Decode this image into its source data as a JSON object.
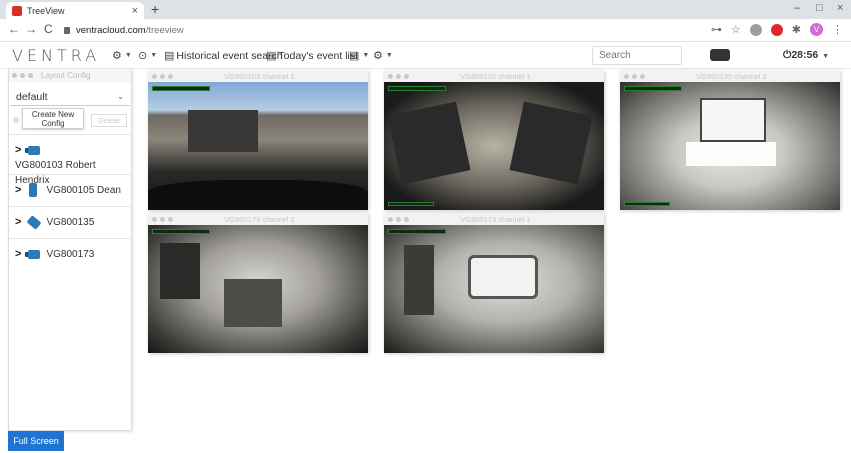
{
  "browser": {
    "tab_title": "TreeView",
    "tab_close": "×",
    "new_tab": "+",
    "url_domain": "ventracloud.com",
    "url_path": "/treeview",
    "nav_back": "←",
    "nav_forward": "→",
    "nav_reload": "C",
    "win_minimize": "–",
    "win_maximize": "□",
    "win_close": "×",
    "ext_key": "⊶",
    "ext_star": "☆",
    "ext_puzzle": "✱",
    "ext_menu": "⋮",
    "avatar_letter": "V"
  },
  "toolbar": {
    "brand": "VENTRA",
    "historical_label": "Historical event search",
    "today_label": "Today's event list",
    "search_placeholder": "Search",
    "timer": "28:56",
    "caret": "▼"
  },
  "sidebar": {
    "title": "Layout Config",
    "selected_config": "default",
    "create_button": "Create New Config",
    "delete_button": "Delete",
    "devices": [
      {
        "label": "VG800103 Robert Hendrix",
        "icon": "camera-icon"
      },
      {
        "label": "VG800105 Dean",
        "icon": "camera-vertical-icon"
      },
      {
        "label": "VG800135",
        "icon": "camera-tilted-icon"
      },
      {
        "label": "VG800173",
        "icon": "camera-icon"
      }
    ]
  },
  "fullscreen_label": "Full Screen",
  "cameras": [
    {
      "title": "VG800103 channel 1"
    },
    {
      "title": "VG800135 channel 1"
    },
    {
      "title": "VG800135 channel 2"
    },
    {
      "title": "VG800173 channel 2"
    },
    {
      "title": "VG800173 channel 1"
    }
  ],
  "colors": {
    "accent": "#1f73d3",
    "device_icon": "#2a7bb5",
    "avatar": "#d36ad7"
  }
}
